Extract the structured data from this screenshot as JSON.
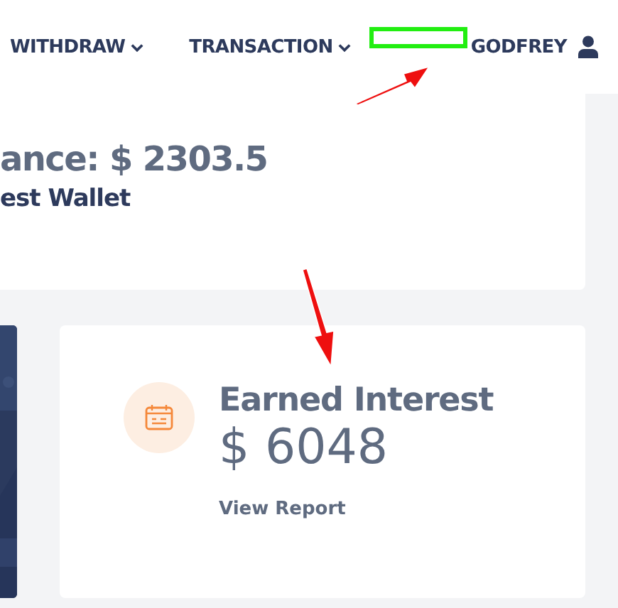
{
  "nav": {
    "items": [
      {
        "label": "WITHDRAW",
        "dropdown": true
      },
      {
        "label": "TRANSACTION",
        "dropdown": true
      }
    ],
    "user": {
      "name": "GODFREY"
    }
  },
  "balance_card": {
    "amount": "ance: $ 2303.5",
    "wallet": "est Wallet"
  },
  "interest_card": {
    "title": "Earned Interest",
    "amount": "$ 6048",
    "link": "View Report"
  },
  "annotations": [
    {
      "kind": "redaction"
    },
    {
      "kind": "arrow-up-right"
    },
    {
      "kind": "arrow-down"
    }
  ]
}
